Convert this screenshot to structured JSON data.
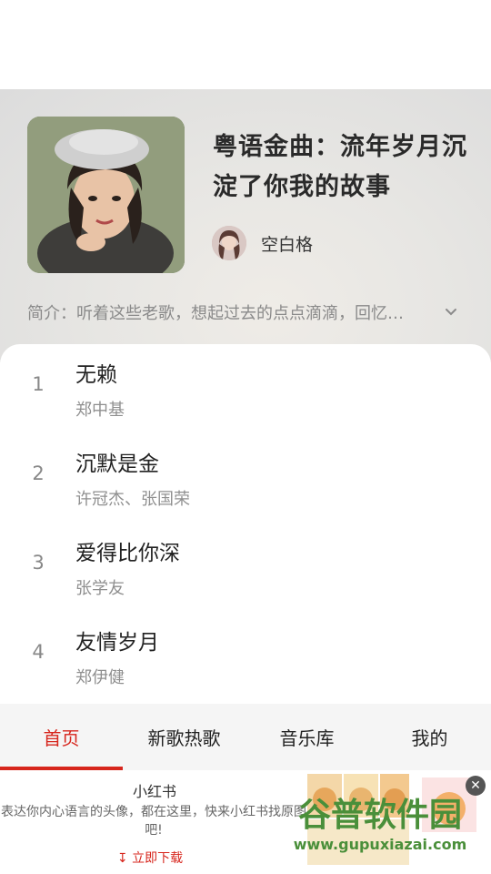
{
  "playlist": {
    "title": "粤语金曲：流年岁月沉淀了你我的故事",
    "creator": "空白格",
    "intro": "简介：听着这些老歌，想起过去的点点滴滴，回忆…"
  },
  "songs": [
    {
      "index": "1",
      "title": "无赖",
      "artist": "郑中基"
    },
    {
      "index": "2",
      "title": "沉默是金",
      "artist": "许冠杰、张国荣"
    },
    {
      "index": "3",
      "title": "爱得比你深",
      "artist": "张学友"
    },
    {
      "index": "4",
      "title": "友情岁月",
      "artist": "郑伊健"
    }
  ],
  "tabs": [
    {
      "label": "首页",
      "active": true
    },
    {
      "label": "新歌热歌",
      "active": false
    },
    {
      "label": "音乐库",
      "active": false
    },
    {
      "label": "我的",
      "active": false
    }
  ],
  "ad": {
    "title": "小红书",
    "description": "表达你内心语言的头像，都在这里，快来小红书找原图吧!",
    "download": "立即下载",
    "close_icon": "close-icon"
  },
  "watermark": {
    "main": "谷普软件园",
    "url": "www.gupuxiazai.com"
  },
  "colors": {
    "accent": "#d7261d",
    "tab_background": "#f5f5f5"
  }
}
